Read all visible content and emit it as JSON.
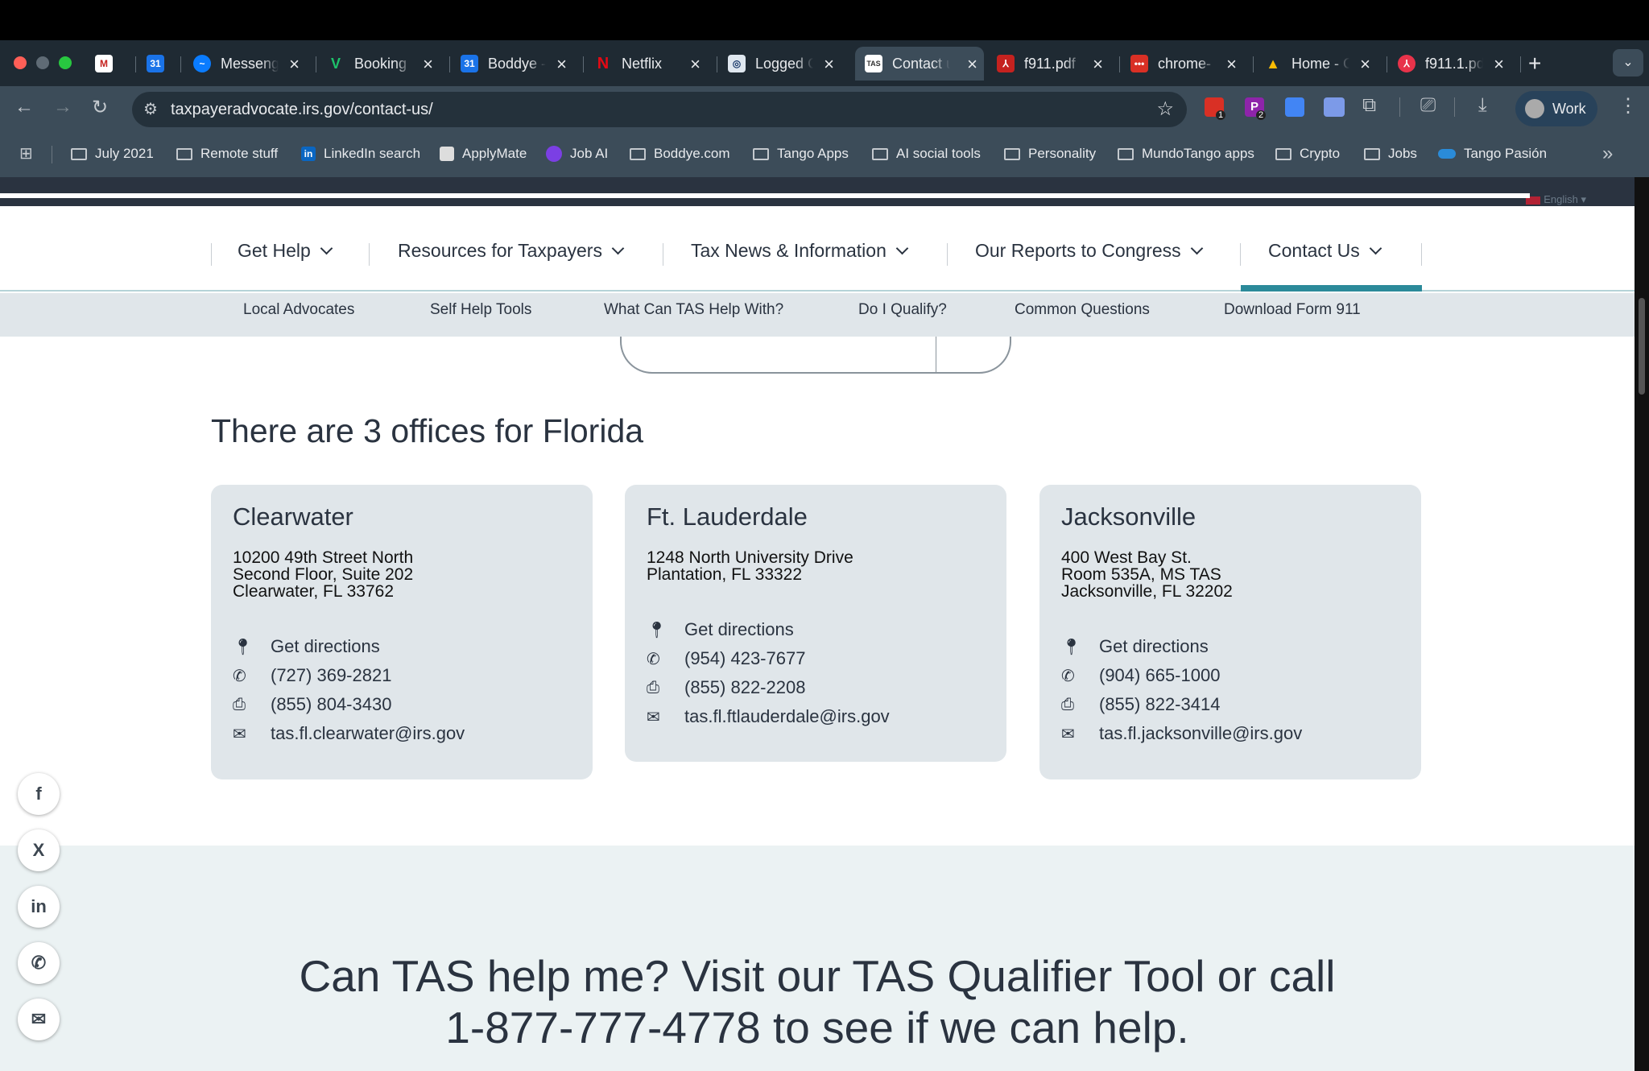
{
  "browser": {
    "tabs": [
      {
        "title": "",
        "icon": "gmail-icon"
      },
      {
        "title": "",
        "icon": "calendar-icon"
      },
      {
        "title": "Messeng",
        "icon": "messenger-icon"
      },
      {
        "title": "Booking",
        "icon": "booking-icon"
      },
      {
        "title": "Boddye -",
        "icon": "calendar-icon"
      },
      {
        "title": "Netflix",
        "icon": "netflix-icon"
      },
      {
        "title": "Logged C",
        "icon": "logged-icon"
      },
      {
        "title": "Contact u",
        "icon": "tas-icon"
      },
      {
        "title": "f911.pdf",
        "icon": "pdf-icon"
      },
      {
        "title": "chrome-",
        "icon": "chrome-icon"
      },
      {
        "title": "Home - C",
        "icon": "drive-icon"
      },
      {
        "title": "f911.1.pd",
        "icon": "pdf-icon"
      }
    ],
    "new_tab_glyph": "+",
    "url": "taxpayeradvocate.irs.gov/contact-us/",
    "profile_label": "Work",
    "ext_badges": [
      "1",
      "2"
    ],
    "bookmarks": [
      "July 2021",
      "Remote stuff",
      "LinkedIn search",
      "ApplyMate",
      "Job AI",
      "Boddye.com",
      "Tango Apps",
      "AI social tools",
      "Personality",
      "MundoTango apps",
      "Crypto",
      "Jobs",
      "Tango Pasión"
    ],
    "bookmarks_more": "»"
  },
  "site": {
    "language": "English",
    "main_nav": [
      "Get Help",
      "Resources for Taxpayers",
      "Tax News & Information",
      "Our Reports to Congress",
      "Contact Us"
    ],
    "sub_nav": [
      "Local Advocates",
      "Self Help Tools",
      "What Can TAS Help With?",
      "Do I Qualify?",
      "Common Questions",
      "Download Form 911"
    ],
    "offices_heading": "There are 3 offices for Florida",
    "offices": [
      {
        "name": "Clearwater",
        "address": [
          "10200 49th Street North",
          "Second Floor, Suite 202",
          "Clearwater, FL 33762"
        ],
        "directions": "Get directions",
        "phone": "(727) 369-2821",
        "fax": "(855) 804-3430",
        "email": "tas.fl.clearwater@irs.gov"
      },
      {
        "name": "Ft. Lauderdale",
        "address": [
          "1248 North University Drive",
          "Plantation, FL 33322"
        ],
        "directions": "Get directions",
        "phone": "(954) 423-7677",
        "fax": "(855) 822-2208",
        "email": "tas.fl.ftlauderdale@irs.gov"
      },
      {
        "name": "Jacksonville",
        "address": [
          "400 West Bay St.",
          "Room 535A, MS TAS",
          "Jacksonville, FL 32202"
        ],
        "directions": "Get directions",
        "phone": "(904) 665-1000",
        "fax": "(855) 822-3414",
        "email": "tas.fl.jacksonville@irs.gov"
      }
    ],
    "cta": [
      "Can TAS help me? Visit our TAS Qualifier Tool or call",
      "1-877-777-4778 to see if we can help."
    ],
    "social": [
      "f",
      "X",
      "in",
      "✆",
      "✉"
    ]
  }
}
